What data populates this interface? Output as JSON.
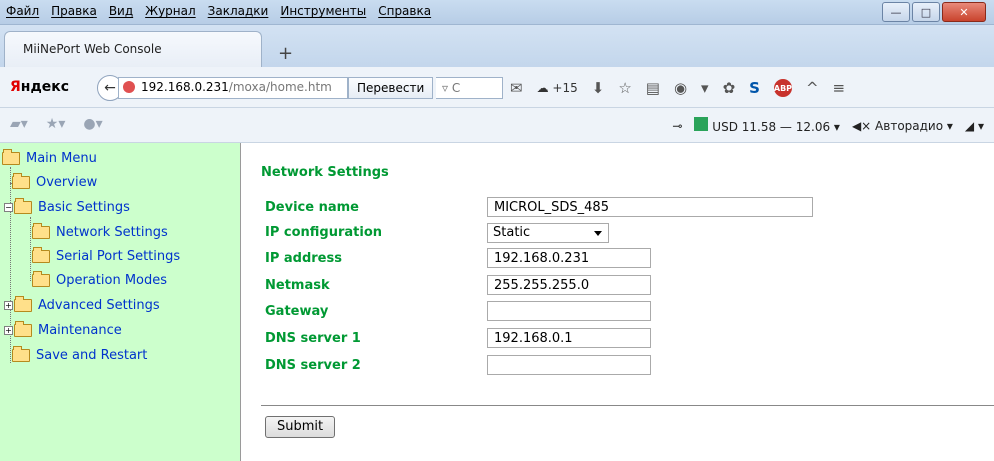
{
  "menubar": {
    "items": [
      "Файл",
      "Правка",
      "Вид",
      "Журнал",
      "Закладки",
      "Инструменты",
      "Справка"
    ]
  },
  "tab": {
    "title": "MiiNePort Web Console"
  },
  "navbar": {
    "brand": "Яндекс",
    "url_host": "192.168.0.231",
    "url_path": "/moxa/home.htm",
    "translate_label": "Перевести",
    "weather": "+15"
  },
  "toolbar2": {
    "currency": "USD 11.58 — 12.06",
    "radio": "Авторадио"
  },
  "menu": {
    "root": "Main Menu",
    "overview": "Overview",
    "basic": "Basic Settings",
    "network": "Network Settings",
    "serial": "Serial Port Settings",
    "operation": "Operation Modes",
    "advanced": "Advanced Settings",
    "maintenance": "Maintenance",
    "save": "Save and Restart"
  },
  "form": {
    "heading": "Network Settings",
    "device_name_label": "Device name",
    "device_name": "MICROL_SDS_485",
    "ip_config_label": "IP configuration",
    "ip_config": "Static",
    "ip_label": "IP address",
    "ip": "192.168.0.231",
    "netmask_label": "Netmask",
    "netmask": "255.255.255.0",
    "gateway_label": "Gateway",
    "gateway": "",
    "dns1_label": "DNS server 1",
    "dns1": "192.168.0.1",
    "dns2_label": "DNS server 2",
    "dns2": "",
    "submit_label": "Submit"
  },
  "colors": {
    "label_green": "#009933",
    "menu_bg": "#ccffcc",
    "menu_link": "#0033cc"
  }
}
